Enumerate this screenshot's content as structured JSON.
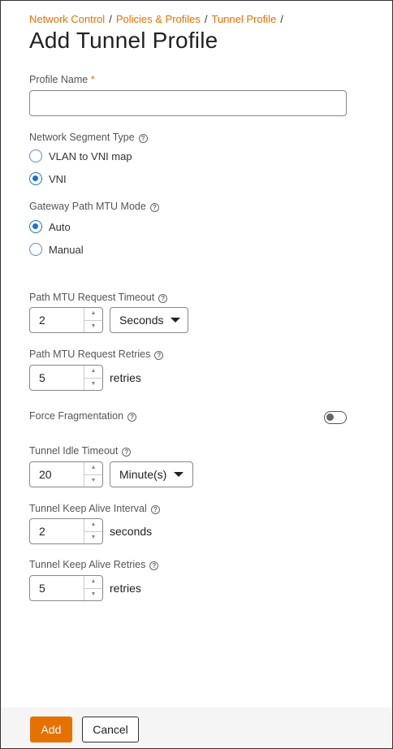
{
  "breadcrumb": {
    "items": [
      "Network Control",
      "Policies & Profiles",
      "Tunnel Profile"
    ],
    "separator": "/"
  },
  "page_title": "Add Tunnel Profile",
  "profile_name": {
    "label": "Profile Name",
    "required_mark": "*",
    "value": ""
  },
  "network_segment_type": {
    "label": "Network Segment Type",
    "options": [
      "VLAN to VNI map",
      "VNI"
    ],
    "selected": "VNI"
  },
  "gateway_path_mtu_mode": {
    "label": "Gateway Path MTU Mode",
    "options": [
      "Auto",
      "Manual"
    ],
    "selected": "Auto"
  },
  "path_mtu_request_timeout": {
    "label": "Path MTU Request Timeout",
    "value": "2",
    "unit": "Seconds"
  },
  "path_mtu_request_retries": {
    "label": "Path MTU Request Retries",
    "value": "5",
    "unit": "retries"
  },
  "force_fragmentation": {
    "label": "Force Fragmentation",
    "enabled": false
  },
  "tunnel_idle_timeout": {
    "label": "Tunnel Idle Timeout",
    "value": "20",
    "unit": "Minute(s)"
  },
  "tunnel_keep_alive_interval": {
    "label": "Tunnel Keep Alive Interval",
    "value": "2",
    "unit": "seconds"
  },
  "tunnel_keep_alive_retries": {
    "label": "Tunnel Keep Alive Retries",
    "value": "5",
    "unit": "retries"
  },
  "help_glyph": "?",
  "stepper_up": "▲",
  "stepper_down": "▼",
  "footer": {
    "add_label": "Add",
    "cancel_label": "Cancel"
  },
  "colors": {
    "accent": "#e57200",
    "radio_selected": "#1a73c8"
  }
}
